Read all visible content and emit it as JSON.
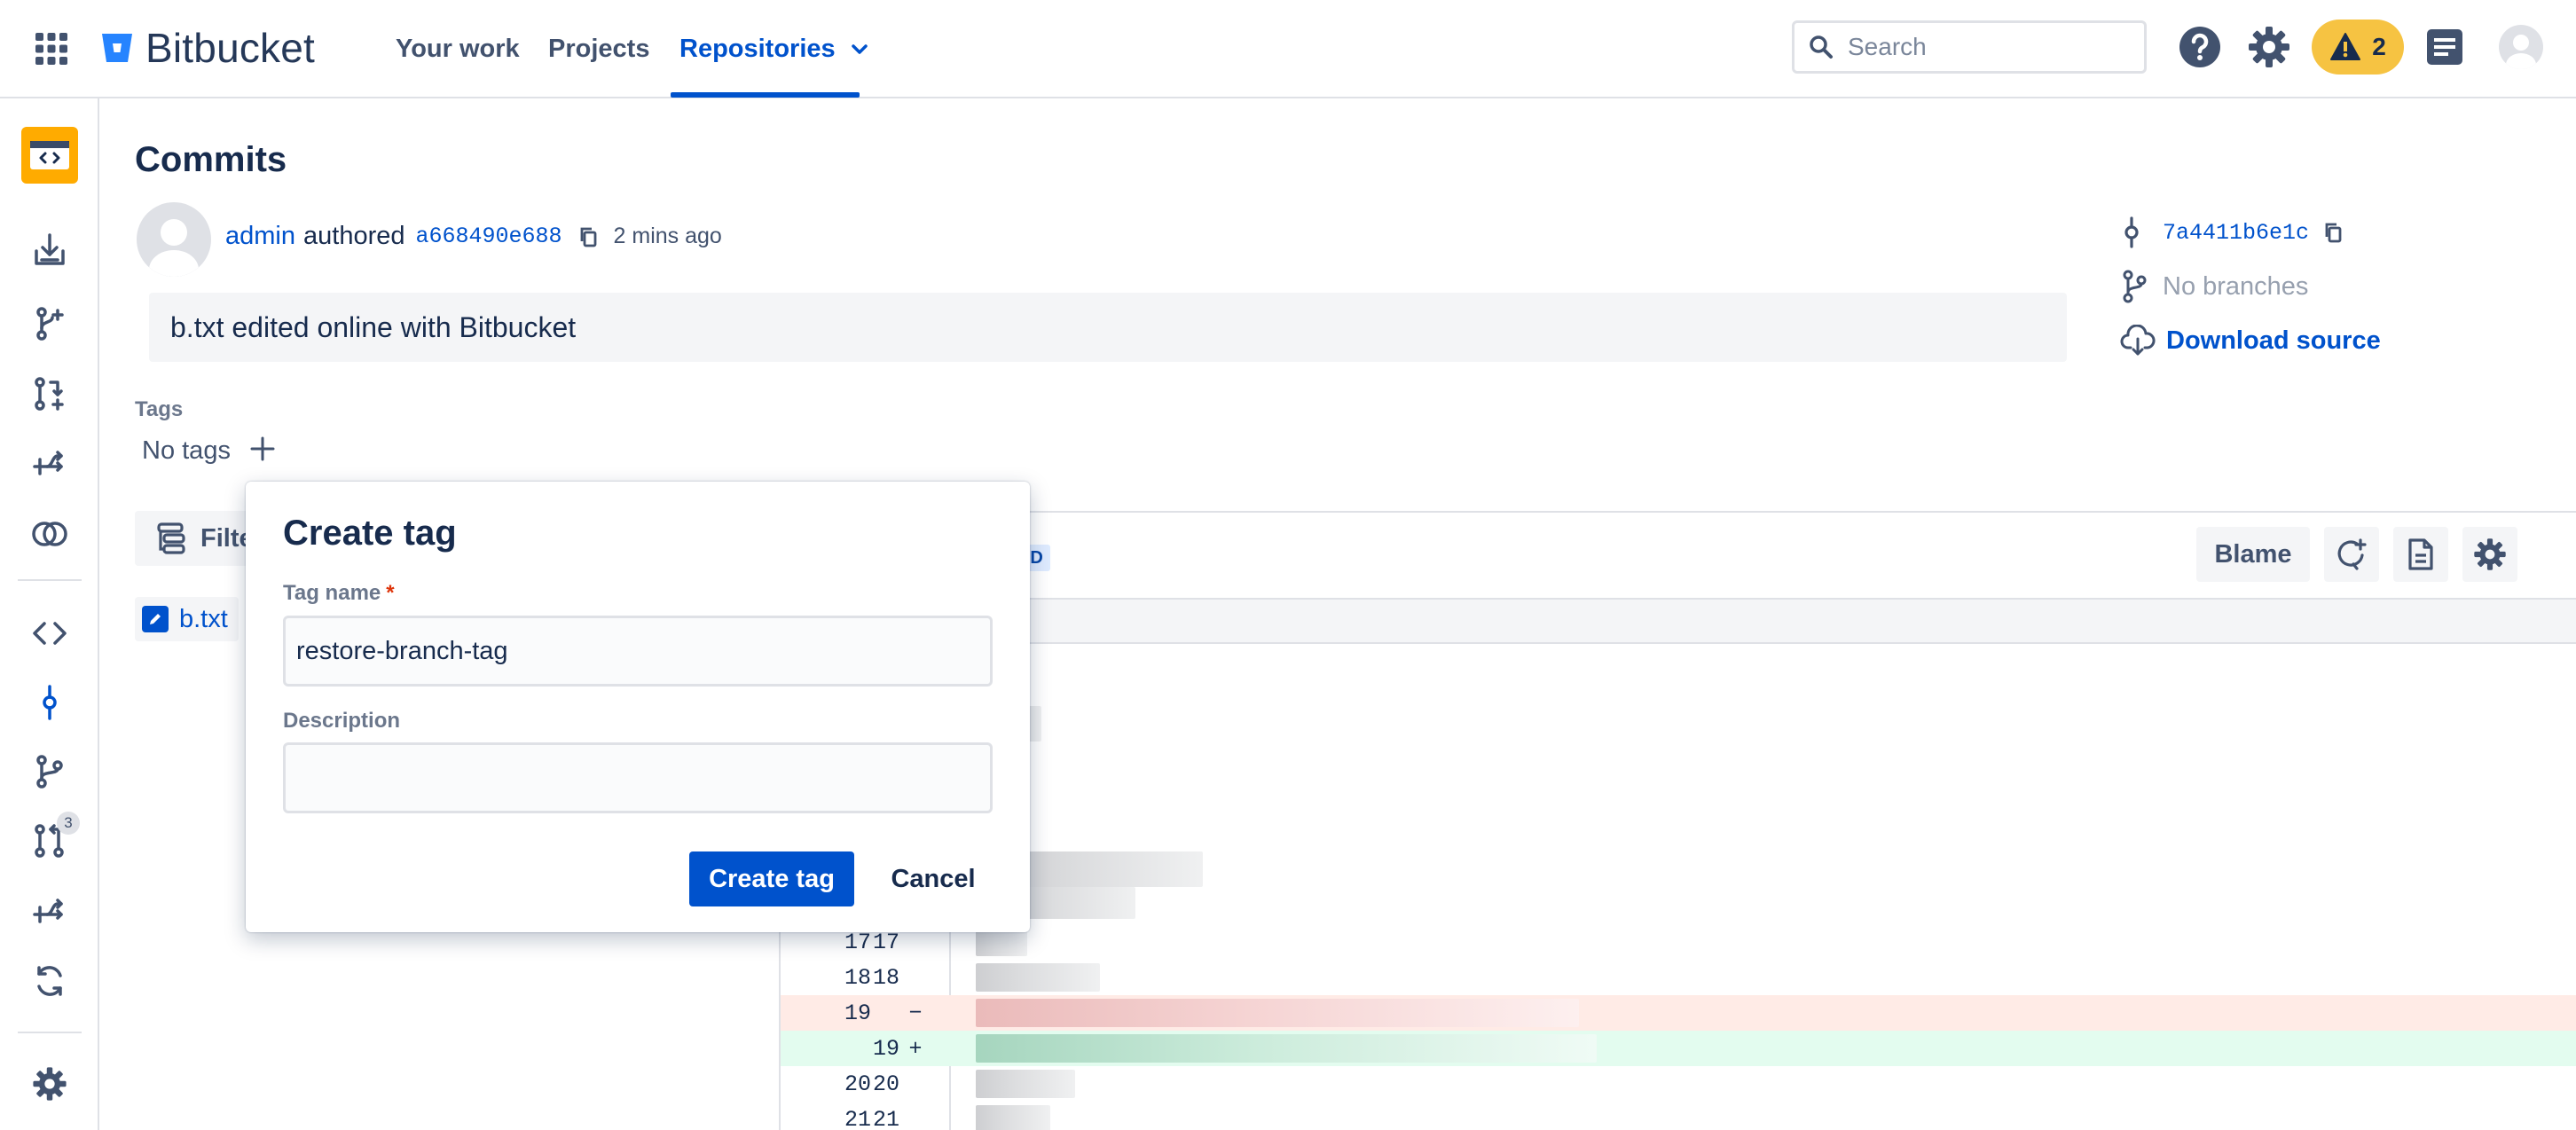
{
  "colors": {
    "brand_blue": "#0052cc",
    "text_primary": "#172b4d",
    "text_subtle": "#42526e",
    "warning_badge": "#f6c342",
    "removed_bg": "#ffebe6",
    "added_bg": "#e3fcef"
  },
  "topnav": {
    "app_switcher_icon": "grid-icon",
    "logo_icon": "bitbucket-bucket-icon",
    "logo_text": "Bitbucket",
    "items": [
      {
        "label": "Your work",
        "active": false
      },
      {
        "label": "Projects",
        "active": false
      },
      {
        "label": "Repositories",
        "active": true,
        "dropdown_icon": "chevron-down-icon"
      }
    ],
    "search": {
      "placeholder": "Search",
      "value": "",
      "icon": "search-icon"
    },
    "help_icon": "question-circle-icon",
    "settings_icon": "gear-icon",
    "alert_badge": {
      "icon": "warning-triangle-icon",
      "count": "2"
    },
    "notifications_icon": "notification-feed-icon",
    "profile_icon": "user-avatar-icon"
  },
  "sidebar": {
    "repo_avatar_icon": "code-repository-icon",
    "items": [
      {
        "icon": "clone-icon"
      },
      {
        "icon": "create-branch-icon"
      },
      {
        "icon": "create-pull-request-icon"
      },
      {
        "icon": "fork-icon"
      },
      {
        "icon": "compare-icon"
      },
      {
        "icon": "source-code-icon"
      },
      {
        "icon": "commits-icon",
        "active": true
      },
      {
        "icon": "branches-icon"
      },
      {
        "icon": "pull-requests-icon",
        "badge": "3"
      },
      {
        "icon": "forks-icon"
      },
      {
        "icon": "sync-icon"
      },
      {
        "icon": "repository-settings-icon"
      }
    ]
  },
  "main": {
    "title": "Commits",
    "commit": {
      "author": "admin",
      "verb": "authored",
      "hash": "a668490e688",
      "copy_icon": "copy-icon",
      "time_ago": "2 mins ago",
      "message": "b.txt edited online with Bitbucket"
    },
    "tags": {
      "label": "Tags",
      "empty_text": "No tags",
      "add_icon": "plus-icon"
    },
    "commit_side": {
      "parent_hash": "7a4411b6e1c",
      "branches_text": "No branches",
      "download_label": "Download source"
    },
    "file_tree": {
      "filter_label": "Filter",
      "files": [
        {
          "name": "b.txt",
          "icon": "pencil-edit-icon"
        }
      ]
    },
    "diff": {
      "status_lozenge": "ED",
      "blame_label": "Blame",
      "rows": [
        {
          "old": "17",
          "new": "17",
          "sign": "",
          "type": "context"
        },
        {
          "old": "18",
          "new": "18",
          "sign": "",
          "type": "context"
        },
        {
          "old": "19",
          "new": "",
          "sign": "−",
          "type": "removed"
        },
        {
          "old": "",
          "new": "19",
          "sign": "+",
          "type": "added"
        },
        {
          "old": "20",
          "new": "20",
          "sign": "",
          "type": "context"
        },
        {
          "old": "21",
          "new": "21",
          "sign": "",
          "type": "context"
        }
      ]
    }
  },
  "create_tag_dialog": {
    "title": "Create tag",
    "tag_name_label": "Tag name",
    "required_marker": "*",
    "tag_name_value": "restore-branch-tag",
    "description_label": "Description",
    "description_value": "",
    "create_button": "Create tag",
    "cancel_button": "Cancel"
  }
}
